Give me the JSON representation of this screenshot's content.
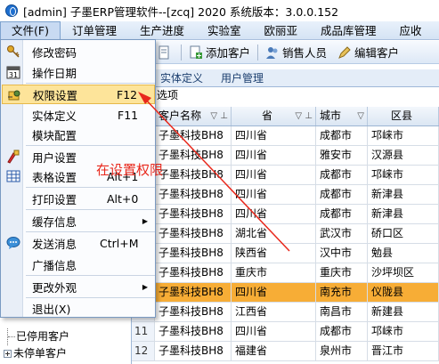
{
  "window": {
    "title": "[admin] 子墨ERP管理软件--[zcq] 2020 系统版本：3.0.0.152"
  },
  "menubar": {
    "items": [
      {
        "label": "文件(F)"
      },
      {
        "label": "订单管理"
      },
      {
        "label": "生产进度"
      },
      {
        "label": "实验室"
      },
      {
        "label": "欧丽亚"
      },
      {
        "label": "成品库管理"
      },
      {
        "label": "应收"
      }
    ]
  },
  "toolbar": {
    "add_customer": "添加客户",
    "sales_person": "销售人员",
    "edit_customer": "编辑客户"
  },
  "tabs": {
    "items": [
      {
        "label": "实体定义"
      },
      {
        "label": "用户管理"
      }
    ],
    "sub": "选项"
  },
  "file_menu": {
    "items": [
      {
        "label": "修改密码",
        "shortcut": "",
        "icon": "key-icon"
      },
      {
        "label": "操作日期",
        "shortcut": "",
        "icon": "calendar-icon"
      },
      {
        "label": "权限设置",
        "shortcut": "F12",
        "icon": "permission-icon"
      },
      {
        "label": "实体定义",
        "shortcut": "F11",
        "icon": ""
      },
      {
        "label": "模块配置",
        "shortcut": "",
        "icon": ""
      },
      {
        "label": "用户设置",
        "shortcut": "",
        "icon": "user-settings-icon"
      },
      {
        "label": "表格设置",
        "shortcut": "Alt+1",
        "icon": "table-icon"
      },
      {
        "label": "打印设置",
        "shortcut": "Alt+0",
        "icon": ""
      },
      {
        "label": "缓存信息",
        "shortcut": "",
        "icon": ""
      },
      {
        "label": "发送消息",
        "shortcut": "Ctrl+M",
        "icon": "message-icon"
      },
      {
        "label": "广播信息",
        "shortcut": "",
        "icon": ""
      },
      {
        "label": "更改外观",
        "shortcut": "",
        "icon": ""
      },
      {
        "label": "退出(X)",
        "shortcut": "",
        "icon": ""
      }
    ]
  },
  "annotation": {
    "text": "在设置权限"
  },
  "grid": {
    "columns": [
      "客户名称",
      "省",
      "城市",
      "区县"
    ],
    "rows": [
      {
        "n": "",
        "name": "子墨科技BH8",
        "prov": "四川省",
        "city": "成都市",
        "county": "邛崃市"
      },
      {
        "n": "",
        "name": "子墨科技BH8",
        "prov": "四川省",
        "city": "雅安市",
        "county": "汉源县"
      },
      {
        "n": "",
        "name": "子墨科技BH8",
        "prov": "四川省",
        "city": "成都市",
        "county": "邛崃市"
      },
      {
        "n": "",
        "name": "子墨科技BH8",
        "prov": "四川省",
        "city": "成都市",
        "county": "新津县"
      },
      {
        "n": "",
        "name": "子墨科技BH8",
        "prov": "四川省",
        "city": "成都市",
        "county": "新津县"
      },
      {
        "n": "",
        "name": "子墨科技BH8",
        "prov": "湖北省",
        "city": "武汉市",
        "county": "硚口区"
      },
      {
        "n": "",
        "name": "子墨科技BH8",
        "prov": "陕西省",
        "city": "汉中市",
        "county": "勉县"
      },
      {
        "n": "",
        "name": "子墨科技BH8",
        "prov": "重庆市",
        "city": "重庆市",
        "county": "沙坪坝区"
      },
      {
        "n": "",
        "name": "子墨科技BH8",
        "prov": "四川省",
        "city": "南充市",
        "county": "仪陇县"
      },
      {
        "n": "",
        "name": "子墨科技BH8",
        "prov": "江西省",
        "city": "南昌市",
        "county": "新建县"
      },
      {
        "n": "11",
        "name": "子墨科技BH8",
        "prov": "四川省",
        "city": "成都市",
        "county": "邛崃市"
      },
      {
        "n": "12",
        "name": "子墨科技BH8",
        "prov": "福建省",
        "city": "泉州市",
        "county": "晋江市"
      }
    ],
    "selected_row": 8
  },
  "tree": {
    "items": [
      {
        "label": "已停用客户"
      },
      {
        "label": "未停单客户"
      }
    ]
  },
  "colors": {
    "menu_highlight": "#fde49a",
    "selected_row": "#f7ad36",
    "annotation": "#e8281c"
  }
}
